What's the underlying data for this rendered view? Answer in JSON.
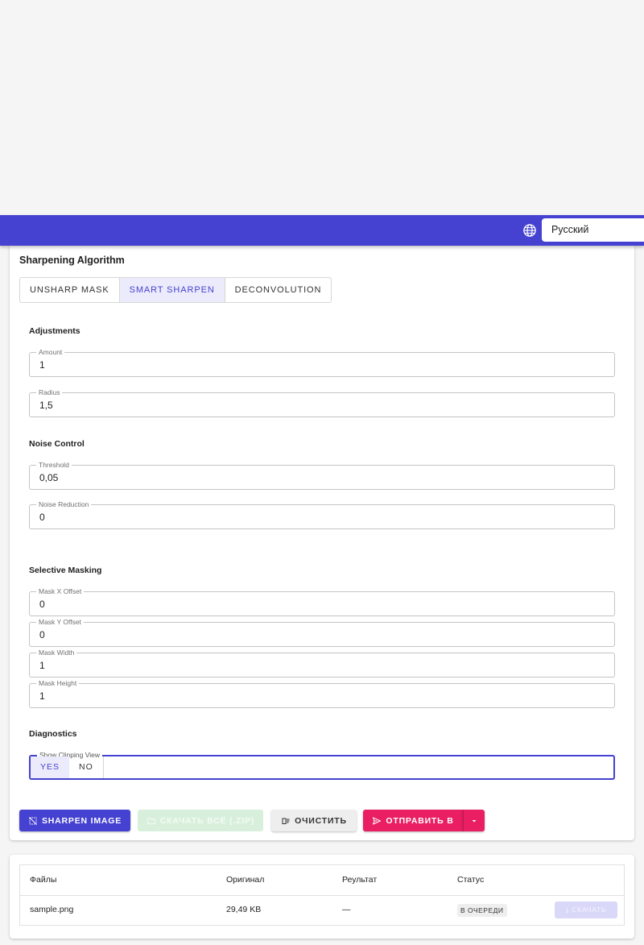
{
  "header": {
    "language_icon": "globe-icon",
    "language_selected": "Русский",
    "accent_color": "#4541d1"
  },
  "algorithm": {
    "title": "Sharpening Algorithm",
    "options": [
      "UNSHARP MASK",
      "SMART SHARPEN",
      "DECONVOLUTION"
    ],
    "selected": "SMART SHARPEN"
  },
  "adjustments": {
    "title": "Adjustments",
    "amount_label": "Amount",
    "amount_value": "1",
    "radius_label": "Radius",
    "radius_value": "1,5"
  },
  "noise": {
    "title": "Noise Control",
    "threshold_label": "Threshold",
    "threshold_value": "0,05",
    "reduction_label": "Noise Reduction",
    "reduction_value": "0"
  },
  "masking": {
    "title": "Selective Masking",
    "x_label": "Mask X Offset",
    "x_value": "0",
    "y_label": "Mask Y Offset",
    "y_value": "0",
    "w_label": "Mask Width",
    "w_value": "1",
    "h_label": "Mask Height",
    "h_value": "1"
  },
  "diagnostics": {
    "title": "Diagnostics",
    "clipping_label": "Show Clipping View",
    "yes": "YES",
    "no": "NO",
    "selected": "YES"
  },
  "actions": {
    "sharpen": "SHARPEN IMAGE",
    "download_all": "СКАЧАТЬ ВСЁ (.ZIP)",
    "clear": "ОЧИСТИТЬ",
    "send": "ОТПРАВИТЬ В",
    "send_color": "#e91e63"
  },
  "files": {
    "columns": [
      "Файлы",
      "Оригинал",
      "Реультат",
      "Статус"
    ],
    "rows": [
      {
        "name": "sample.png",
        "original": "29,49 KB",
        "result": "—",
        "status": "В ОЧЕРЕДИ",
        "download": "СКАЧАТЬ"
      }
    ]
  }
}
